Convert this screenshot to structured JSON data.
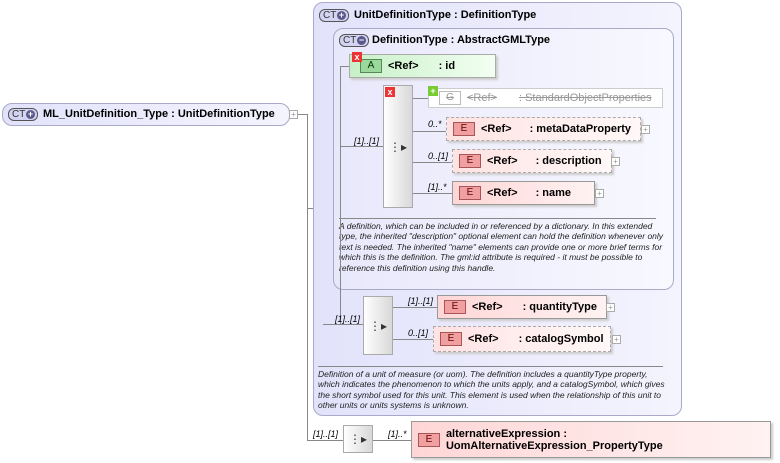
{
  "root": {
    "badge": "CT",
    "label": "ML_UnitDefinition_Type : UnitDefinitionType"
  },
  "outer": {
    "badge": "CT",
    "title": "UnitDefinitionType : DefinitionType",
    "doc": "Definition of a unit of measure (or uom). The definition includes a quantityType property, which indicates the phenomenon to which the units apply, and a catalogSymbol, which gives the short symbol used for this unit. This element is used when the relationship of this unit to other units or units systems is unknown."
  },
  "inner": {
    "badge": "CT",
    "title": "DefinitionType : AbstractGMLType",
    "doc": "A definition, which can be included in or referenced by a dictionary. In this extended type, the inherited \"description\" optional element can hold the definition whenever only text is needed. The inherited \"name\" elements can provide one or more brief terms for which this is the definition. The gml:id attribute is required - it must be possible to reference this definition using this handle."
  },
  "attribute": {
    "badge": "A",
    "ref": "<Ref>",
    "name": ": id"
  },
  "group": {
    "badge": "G",
    "ref": "<Ref>",
    "name": ": StandardObjectProperties"
  },
  "elements": [
    {
      "badge": "E",
      "ref": "<Ref>",
      "name": ": metaDataProperty",
      "card": "0..*"
    },
    {
      "badge": "E",
      "ref": "<Ref>",
      "name": ": description",
      "card": "0..[1]"
    },
    {
      "badge": "E",
      "ref": "<Ref>",
      "name": ": name",
      "card": "[1]..*"
    },
    {
      "badge": "E",
      "ref": "<Ref>",
      "name": ": quantityType",
      "card": "[1]..[1]"
    },
    {
      "badge": "E",
      "ref": "<Ref>",
      "name": ": catalogSymbol",
      "card": "0..[1]"
    },
    {
      "badge": "E",
      "name": "alternativeExpression : UomAlternativeExpression_PropertyType",
      "card": "[1]..*"
    }
  ],
  "seq_cards": {
    "inner": "[1]..[1]",
    "outer": "[1]..[1]",
    "root": "[1]..[1]"
  },
  "icons": {
    "expand": "+",
    "remove": "x",
    "sequence": "sequence-icon"
  }
}
